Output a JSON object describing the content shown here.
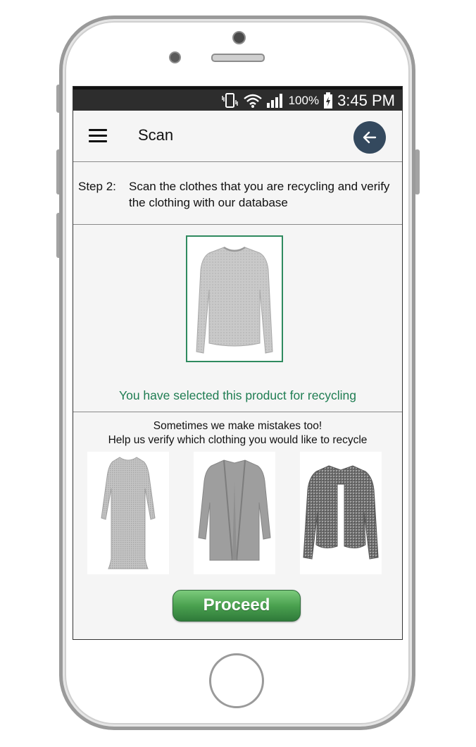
{
  "status_bar": {
    "battery_percent": "100%",
    "time": "3:45 PM",
    "icons": [
      "vibrate-icon",
      "wifi-icon",
      "signal-icon",
      "battery-charging-icon"
    ]
  },
  "app_bar": {
    "title": "Scan",
    "menu_icon": "hamburger-menu-icon",
    "back_icon": "back-arrow-icon",
    "back_button_color": "#34495e"
  },
  "step": {
    "label": "Step 2:",
    "text": "Scan the clothes that you are recycling and verify the clothing with our database"
  },
  "selected_product": {
    "item": "sweater",
    "message": "You have selected this product for recycling",
    "frame_color": "#2f8a5f"
  },
  "verify": {
    "line1": "Sometimes we make mistakes too!",
    "line2": "Help us verify which clothing you would like to recycle",
    "options": [
      "dress",
      "long cardigan",
      "knit cardigan"
    ]
  },
  "proceed_button": {
    "label": "Proceed",
    "color": "#4aa14f"
  }
}
